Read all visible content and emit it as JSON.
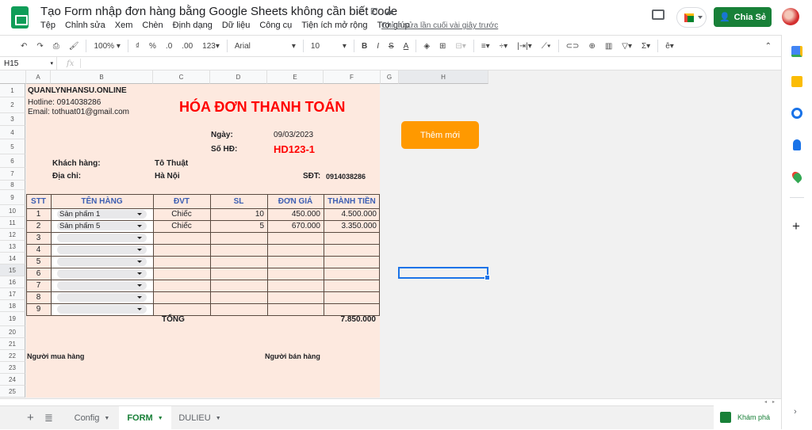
{
  "app": {
    "title": "Tạo Form nhập đơn hàng bằng Google Sheets không cần biết code",
    "last_edit": "Chỉnh sửa lần cuối vài giây trước",
    "share_label": "Chia Sẻ"
  },
  "menu": [
    "Tệp",
    "Chỉnh sửa",
    "Xem",
    "Chèn",
    "Định dạng",
    "Dữ liệu",
    "Công cụ",
    "Tiện ích mở rộng",
    "Trợ giúp"
  ],
  "toolbar": {
    "zoom": "100%",
    "currency": "₫",
    "percent": "%",
    "dec_less": ".0",
    "dec_more": ".00",
    "format": "123",
    "font": "Arial",
    "size": "10"
  },
  "formula_bar": {
    "cell_ref": "H15",
    "fx": "fx",
    "value": ""
  },
  "columns": [
    "A",
    "B",
    "C",
    "D",
    "E",
    "F",
    "G",
    "H"
  ],
  "rows": [
    "1",
    "2",
    "3",
    "4",
    "5",
    "6",
    "7",
    "8",
    "9",
    "10",
    "11",
    "12",
    "13",
    "14",
    "15",
    "16",
    "17",
    "18",
    "19",
    "20",
    "21",
    "22",
    "23",
    "24",
    "25"
  ],
  "form": {
    "company": "QUANLYNHANSU.ONLINE",
    "hotline": "Hotline: 0914038286",
    "email": "Email: tothuat01@gmail.com",
    "title": "HÓA ĐƠN THANH TOÁN",
    "date_label": "Ngày:",
    "date_value": "09/03/2023",
    "invoice_label": "Số HĐ:",
    "invoice_value": "HD123-1",
    "customer_label": "Khách hàng:",
    "customer_value": "Tô Thuật",
    "address_label": "Địa chỉ:",
    "address_value": "Hà Nội",
    "phone_label": "SĐT:",
    "phone_value": "0914038286",
    "headers": [
      "STT",
      "TÊN HÀNG",
      "ĐVT",
      "SL",
      "ĐƠN GIÁ",
      "THÀNH TIỀN"
    ],
    "items": [
      {
        "stt": "1",
        "name": "Sản phẩm 1",
        "unit": "Chiếc",
        "qty": "10",
        "price": "450.000",
        "total": "4.500.000"
      },
      {
        "stt": "2",
        "name": "Sản phẩm 5",
        "unit": "Chiếc",
        "qty": "5",
        "price": "670.000",
        "total": "3.350.000"
      },
      {
        "stt": "3",
        "name": "",
        "unit": "",
        "qty": "",
        "price": "",
        "total": ""
      },
      {
        "stt": "4",
        "name": "",
        "unit": "",
        "qty": "",
        "price": "",
        "total": ""
      },
      {
        "stt": "5",
        "name": "",
        "unit": "",
        "qty": "",
        "price": "",
        "total": ""
      },
      {
        "stt": "6",
        "name": "",
        "unit": "",
        "qty": "",
        "price": "",
        "total": ""
      },
      {
        "stt": "7",
        "name": "",
        "unit": "",
        "qty": "",
        "price": "",
        "total": ""
      },
      {
        "stt": "8",
        "name": "",
        "unit": "",
        "qty": "",
        "price": "",
        "total": ""
      },
      {
        "stt": "9",
        "name": "",
        "unit": "",
        "qty": "",
        "price": "",
        "total": ""
      }
    ],
    "total_label": "TỔNG",
    "total_value": "7.850.000",
    "buyer": "Người mua hàng",
    "seller": "Người bán hàng"
  },
  "add_button": "Thêm mới",
  "tabs": [
    {
      "label": "Config"
    },
    {
      "label": "FORM"
    },
    {
      "label": "DULIEU"
    }
  ],
  "explore_label": "Khám phá",
  "colors": {
    "accent": "#188038",
    "title_red": "#ff0000",
    "header_blue": "#3c5fb3",
    "form_bg": "#fde9df",
    "button_orange": "#ff9900"
  }
}
